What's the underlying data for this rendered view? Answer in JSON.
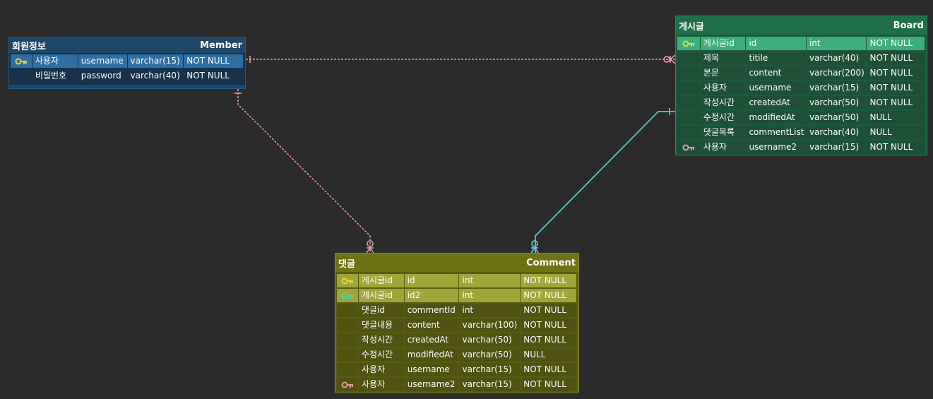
{
  "tables": {
    "member": {
      "kor_title": "회원정보",
      "eng_title": "Member",
      "color": "#1f4767",
      "rows": [
        {
          "key": "pk",
          "label": "사용자",
          "column": "username",
          "type": "varchar(15)",
          "null": "NOT NULL"
        },
        {
          "key": "",
          "label": "비밀번호",
          "column": "password",
          "type": "varchar(40)",
          "null": "NOT NULL"
        }
      ]
    },
    "board": {
      "kor_title": "게시글",
      "eng_title": "Board",
      "color": "#1f6f48",
      "rows": [
        {
          "key": "pk",
          "label": "게시글id",
          "column": "id",
          "type": "int",
          "null": "NOT NULL"
        },
        {
          "key": "",
          "label": "제목",
          "column": "titile",
          "type": "varchar(40)",
          "null": "NOT NULL"
        },
        {
          "key": "",
          "label": "본문",
          "column": "content",
          "type": "varchar(200)",
          "null": "NOT NULL"
        },
        {
          "key": "",
          "label": "사용자",
          "column": "username",
          "type": "varchar(15)",
          "null": "NOT NULL"
        },
        {
          "key": "",
          "label": "작성시간",
          "column": "createdAt",
          "type": "varchar(50)",
          "null": "NOT NULL"
        },
        {
          "key": "",
          "label": "수정시간",
          "column": "modifiedAt",
          "type": "varchar(50)",
          "null": "NULL"
        },
        {
          "key": "",
          "label": "댓글목록",
          "column": "commentList",
          "type": "varchar(40)",
          "null": "NULL"
        },
        {
          "key": "fk",
          "label": "사용자",
          "column": "username2",
          "type": "varchar(15)",
          "null": "NOT NULL"
        }
      ]
    },
    "comment": {
      "kor_title": "댓글",
      "eng_title": "Comment",
      "color": "#6e7312",
      "rows": [
        {
          "key": "pk",
          "label": "게시글id",
          "column": "id",
          "type": "int",
          "null": "NOT NULL"
        },
        {
          "key": "pfk",
          "label": "게시글id",
          "column": "id2",
          "type": "int",
          "null": "NOT NULL"
        },
        {
          "key": "",
          "label": "댓글id",
          "column": "commentId",
          "type": "int",
          "null": "NOT NULL"
        },
        {
          "key": "",
          "label": "댓글내용",
          "column": "content",
          "type": "varchar(100)",
          "null": "NOT NULL"
        },
        {
          "key": "",
          "label": "작성시간",
          "column": "createdAt",
          "type": "varchar(50)",
          "null": "NOT NULL"
        },
        {
          "key": "",
          "label": "수정시간",
          "column": "modifiedAt",
          "type": "varchar(50)",
          "null": "NULL"
        },
        {
          "key": "",
          "label": "사용자",
          "column": "username",
          "type": "varchar(15)",
          "null": "NOT NULL"
        },
        {
          "key": "fk",
          "label": "사용자",
          "column": "username2",
          "type": "varchar(15)",
          "null": "NOT NULL"
        }
      ]
    }
  },
  "icons": {
    "pk": "gold-key-icon",
    "pfk": "teal-key-icon",
    "fk": "pink-key-icon"
  },
  "colors": {
    "pk_key": "#e8d33a",
    "pfk_key": "#3fd6c0",
    "fk_key": "#e89aa6",
    "relation_member": "#f0a0b0",
    "relation_board": "#5ec8d8"
  }
}
